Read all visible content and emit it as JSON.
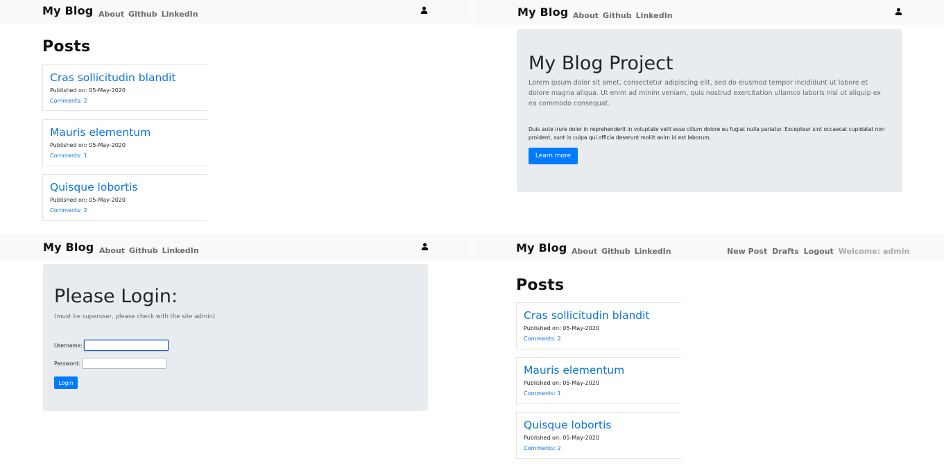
{
  "brand": "My Blog",
  "nav_links": [
    "About",
    "Github",
    "LinkedIn"
  ],
  "posts_heading": "Posts",
  "posts": [
    {
      "title": "Cras sollicitudin blandit",
      "published": "Published on: 05-May-2020",
      "comments": "Comments: 2"
    },
    {
      "title": "Mauris elementum",
      "published": "Published on: 05-May-2020",
      "comments": "Comments: 1"
    },
    {
      "title": "Quisque lobortis",
      "published": "Published on: 05-May-2020",
      "comments": "Comments: 2"
    }
  ],
  "home": {
    "title": "My Blog Project",
    "lead": "Lorem ipsum dolor sit amet, consectetur adipiscing elit, sed do eiusmod tempor incididunt ut labore et dolore magna aliqua. Ut enim ad minim veniam, quis nostrud exercitation ullamco laboris nisi ut aliquip ex ea commodo consequat.",
    "body": "Duis aute irure dolor in reprehenderit in voluptate velit esse cillum dolore eu fugiat nulla pariatur. Excepteur sint occaecat cupidatat non proident, sunt in culpa qui officia deserunt mollit anim id est laborum.",
    "button": "Learn more"
  },
  "login": {
    "title": "Please Login:",
    "subtitle": "(must be superuser, please check with the site admin)",
    "username_label": "Username:",
    "password_label": "Password:",
    "username_value": "",
    "password_value": "",
    "button": "Login"
  },
  "admin_nav": {
    "new_post": "New Post",
    "drafts": "Drafts",
    "logout": "Logout",
    "welcome": "Welcome: admin"
  },
  "colors": {
    "link": "#0a74d8",
    "primary_button": "#007bff",
    "navbar_bg": "#f8f9fa",
    "jumbotron_bg": "#e9ecef"
  },
  "icons": {
    "user": "user-icon"
  }
}
